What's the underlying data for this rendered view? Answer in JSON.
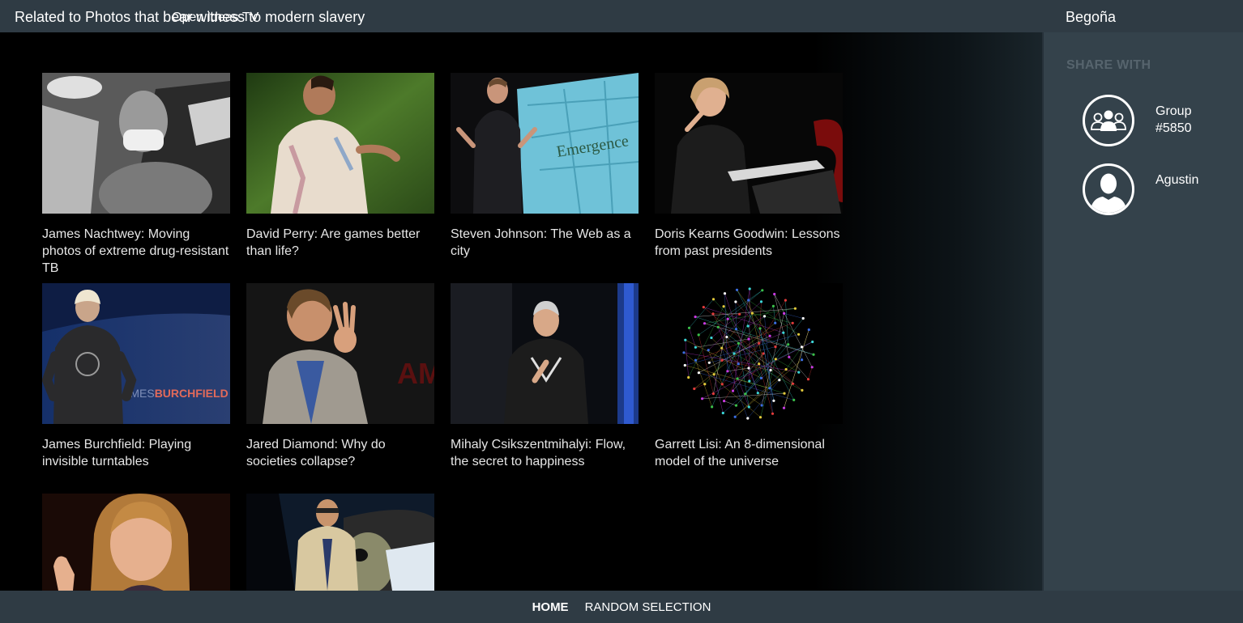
{
  "header": {
    "title": "Related to Photos that bear witness to modern slavery",
    "overlay_title": "Open Ideas TV",
    "user": "Begoña"
  },
  "share": {
    "title": "SHARE WITH",
    "items": [
      {
        "name": "Group #5850",
        "icon": "group-icon"
      },
      {
        "name": "Agustin",
        "icon": "person-icon"
      }
    ]
  },
  "videos": [
    {
      "caption": "James Nachtwey: Moving photos of extreme drug-resistant TB"
    },
    {
      "caption": "David Perry: Are games better than life?"
    },
    {
      "caption": "Steven Johnson: The Web as a city",
      "thumb_text": "Emergence"
    },
    {
      "caption": "Doris Kearns Goodwin: Lessons from past presidents"
    },
    {
      "caption": "James Burchfield: Playing invisible turntables",
      "thumb_text_light": "JAMES",
      "thumb_text_bold": "BURCHFIELD"
    },
    {
      "caption": "Jared Diamond: Why do societies collapse?",
      "thumb_text": "AM"
    },
    {
      "caption": "Mihaly Csikszentmihalyi: Flow, the secret to happiness"
    },
    {
      "caption": "Garrett Lisi: An 8-dimensional model of the universe"
    },
    {
      "caption": ""
    },
    {
      "caption": ""
    }
  ],
  "nav": {
    "home": "HOME",
    "random": "RANDOM SELECTION"
  },
  "colors": {
    "bar": "#2f3b44",
    "panel": "#34424b",
    "share_title": "#56646d"
  }
}
